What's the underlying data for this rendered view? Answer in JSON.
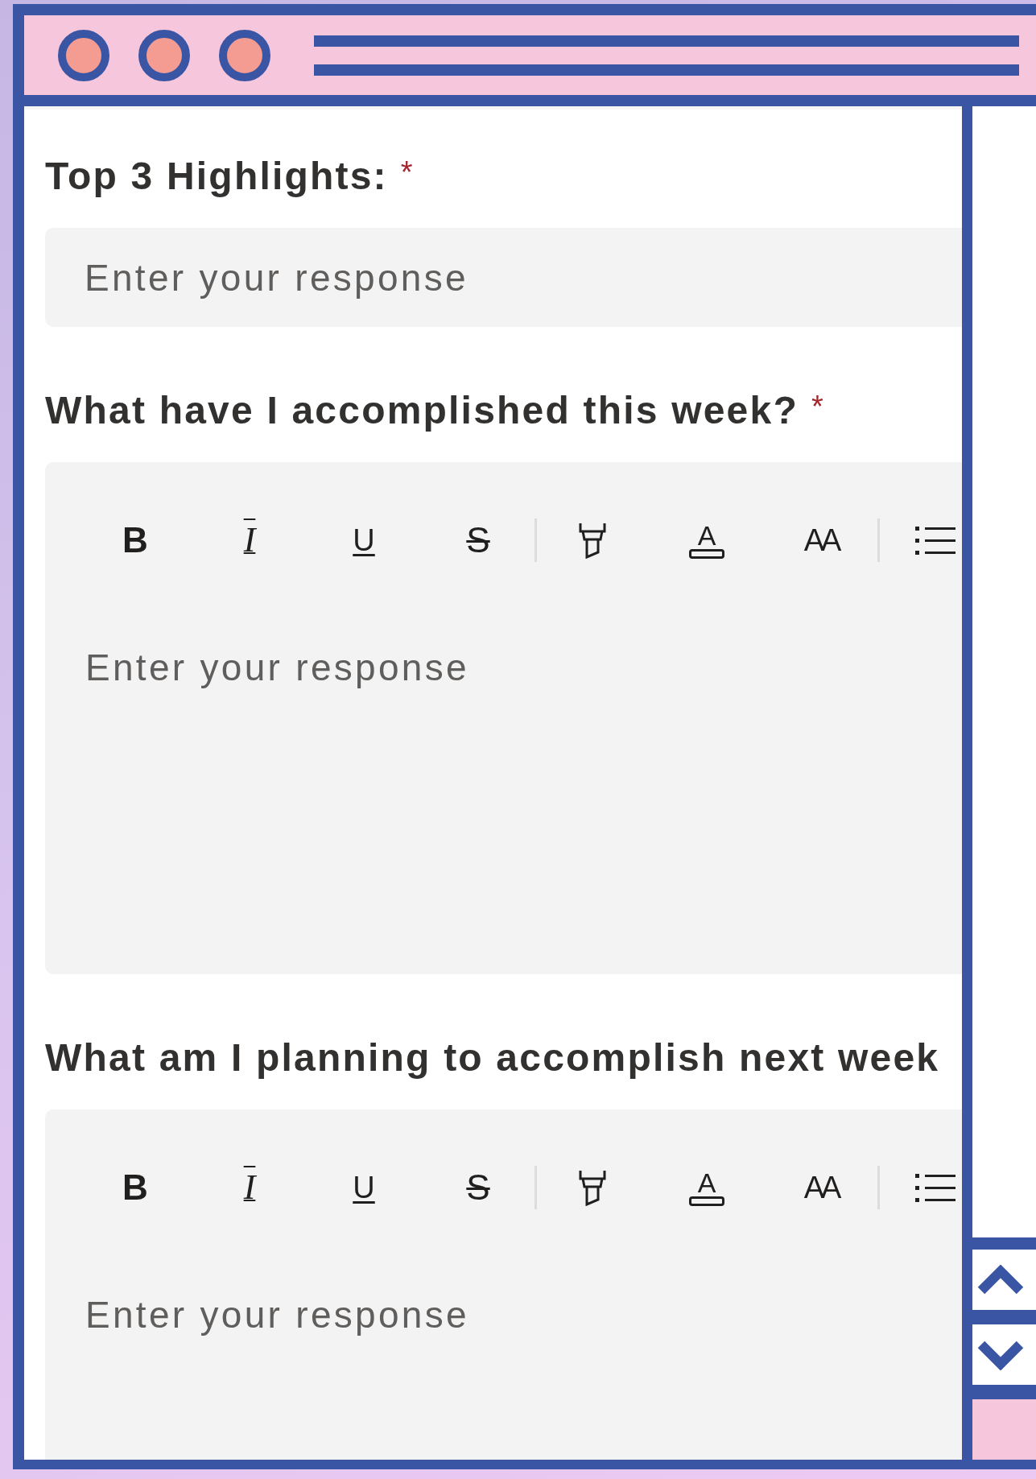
{
  "questions": [
    {
      "label": "Top 3 Highlights:",
      "required_mark": "*",
      "kind": "text",
      "placeholder": "Enter your response"
    },
    {
      "label": "What have I accomplished this week?",
      "required_mark": "*",
      "kind": "rich",
      "placeholder": "Enter your response",
      "toolbar": [
        {
          "kind": "bold",
          "glyph": "B"
        },
        {
          "kind": "italic",
          "glyph": "I"
        },
        {
          "kind": "underline",
          "glyph": "U"
        },
        {
          "kind": "strike",
          "glyph": "S"
        },
        {
          "kind": "divider"
        },
        {
          "kind": "highlight"
        },
        {
          "kind": "font-color",
          "glyph": "A"
        },
        {
          "kind": "font-size",
          "glyph": "AA"
        },
        {
          "kind": "divider"
        },
        {
          "kind": "list"
        }
      ]
    },
    {
      "label": "What am I planning to accomplish next week",
      "kind": "rich",
      "placeholder": "Enter your response",
      "toolbar": [
        {
          "kind": "bold",
          "glyph": "B"
        },
        {
          "kind": "italic",
          "glyph": "I"
        },
        {
          "kind": "underline",
          "glyph": "U"
        },
        {
          "kind": "strike",
          "glyph": "S"
        },
        {
          "kind": "divider"
        },
        {
          "kind": "highlight"
        },
        {
          "kind": "font-color",
          "glyph": "A"
        },
        {
          "kind": "font-size",
          "glyph": "AA"
        },
        {
          "kind": "divider"
        },
        {
          "kind": "list"
        }
      ]
    }
  ]
}
